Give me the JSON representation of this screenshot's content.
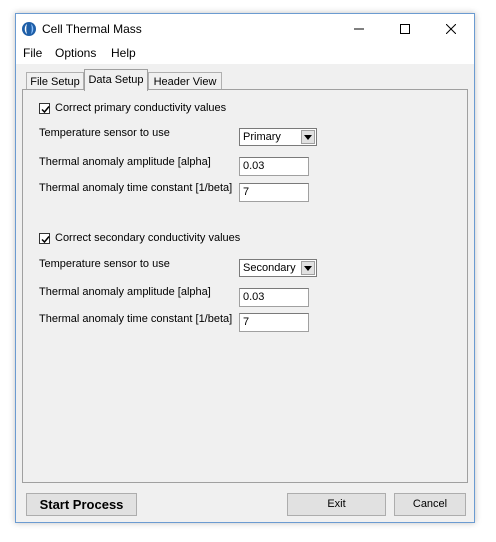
{
  "window": {
    "title": "Cell Thermal Mass"
  },
  "menu": {
    "file": "File",
    "options": "Options",
    "help": "Help"
  },
  "tabs": [
    {
      "label": "File Setup"
    },
    {
      "label": "Data Setup"
    },
    {
      "label": "Header View"
    }
  ],
  "active_tab": "Data Setup",
  "primary": {
    "checkbox_label": "Correct primary conductivity values",
    "checked": true,
    "sensor_label": "Temperature sensor to use",
    "sensor_value": "Primary",
    "alpha_label": "Thermal anomaly amplitude [alpha]",
    "alpha_value": "0.03",
    "beta_label": "Thermal anomaly time constant [1/beta]",
    "beta_value": "7"
  },
  "secondary": {
    "checkbox_label": "Correct secondary conductivity values",
    "checked": true,
    "sensor_label": "Temperature sensor to use",
    "sensor_value": "Secondary",
    "alpha_label": "Thermal anomaly amplitude [alpha]",
    "alpha_value": "0.03",
    "beta_label": "Thermal anomaly time constant [1/beta]",
    "beta_value": "7"
  },
  "buttons": {
    "start": "Start Process",
    "exit": "Exit",
    "cancel": "Cancel"
  },
  "icons": {
    "app": "app-icon",
    "minimize": "minimize-icon",
    "maximize": "maximize-icon",
    "close": "close-icon",
    "dropdown": "chevron-down-icon",
    "check": "check-icon"
  },
  "colors": {
    "window_bg": "#f0f0f0",
    "border": "#6b9bd1",
    "app_icon": "#1f5fa8"
  }
}
